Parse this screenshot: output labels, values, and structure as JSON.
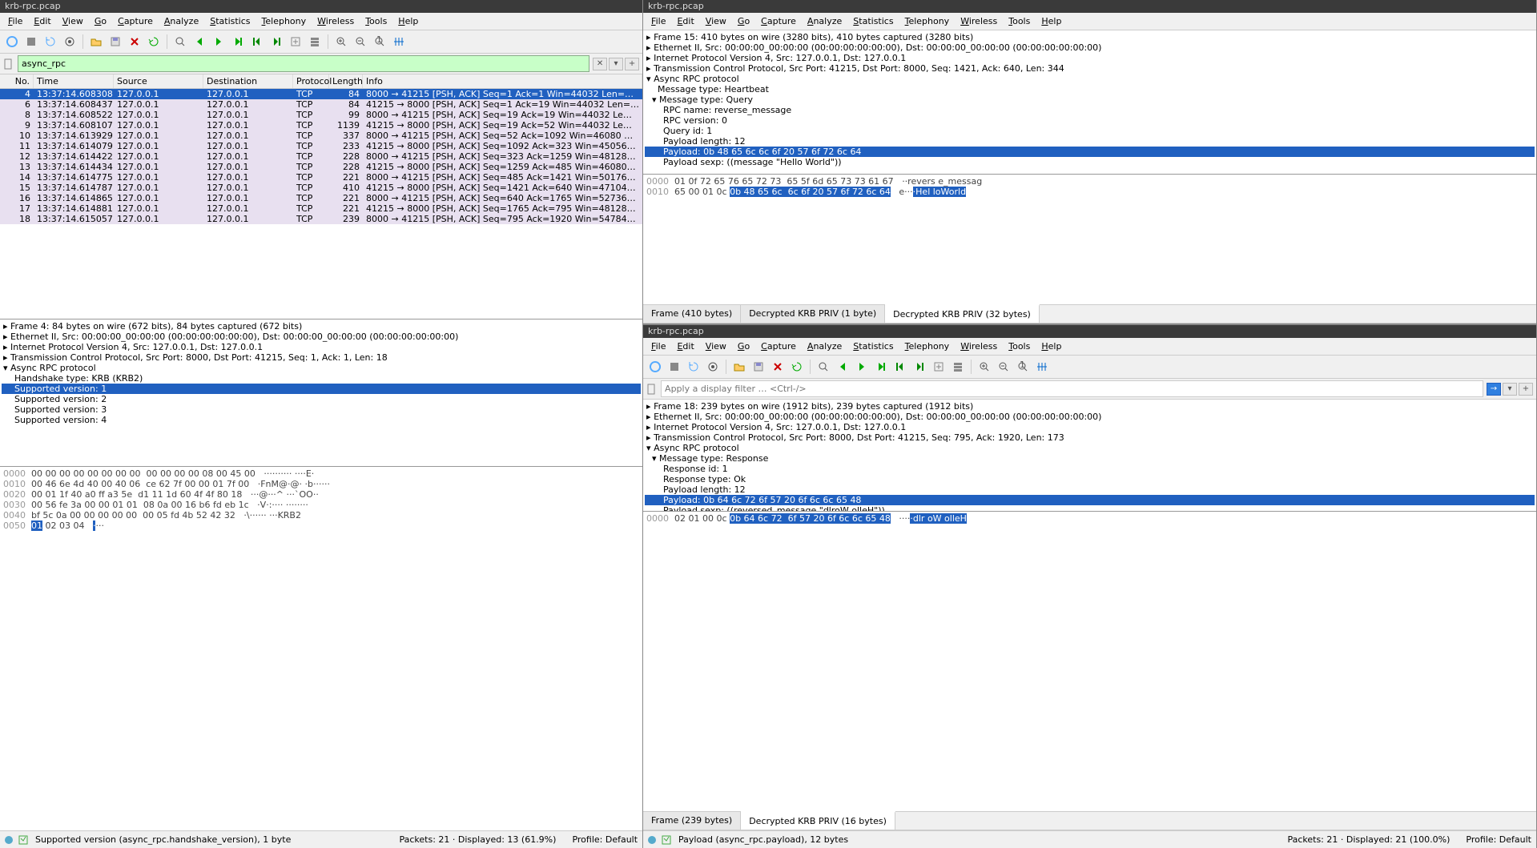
{
  "titles": {
    "left": "krb-rpc.pcap",
    "right_top": "krb-rpc.pcap",
    "right_bot": "krb-rpc.pcap"
  },
  "menu": [
    "File",
    "Edit",
    "View",
    "Go",
    "Capture",
    "Analyze",
    "Statistics",
    "Telephony",
    "Wireless",
    "Tools",
    "Help"
  ],
  "filter": {
    "value": "async_rpc",
    "placeholder": "Apply a display filter … <Ctrl-/>"
  },
  "colhead": {
    "no": "No.",
    "time": "Time",
    "src": "Source",
    "dst": "Destination",
    "proto": "Protocol",
    "len": "Length",
    "info": "Info"
  },
  "packets": [
    {
      "no": 4,
      "time": "13:37:14.608308",
      "src": "127.0.0.1",
      "dst": "127.0.0.1",
      "proto": "TCP",
      "len": 84,
      "info": "8000 → 41215 [PSH, ACK] Seq=1 Ack=1 Win=44032 Len=…",
      "sel": true
    },
    {
      "no": 6,
      "time": "13:37:14.608437",
      "src": "127.0.0.1",
      "dst": "127.0.0.1",
      "proto": "TCP",
      "len": 84,
      "info": "41215 → 8000 [PSH, ACK] Seq=1 Ack=19 Win=44032 Len=…"
    },
    {
      "no": 8,
      "time": "13:37:14.608522",
      "src": "127.0.0.1",
      "dst": "127.0.0.1",
      "proto": "TCP",
      "len": 99,
      "info": "8000 → 41215 [PSH, ACK] Seq=19 Ack=19 Win=44032 Le…"
    },
    {
      "no": 9,
      "time": "13:37:14.608107",
      "src": "127.0.0.1",
      "dst": "127.0.0.1",
      "proto": "TCP",
      "len": 1139,
      "info": "41215 → 8000 [PSH, ACK] Seq=19 Ack=52 Win=44032 Le…"
    },
    {
      "no": 10,
      "time": "13:37:14.613929",
      "src": "127.0.0.1",
      "dst": "127.0.0.1",
      "proto": "TCP",
      "len": 337,
      "info": "8000 → 41215 [PSH, ACK] Seq=52 Ack=1092 Win=46080 …"
    },
    {
      "no": 11,
      "time": "13:37:14.614079",
      "src": "127.0.0.1",
      "dst": "127.0.0.1",
      "proto": "TCP",
      "len": 233,
      "info": "41215 → 8000 [PSH, ACK] Seq=1092 Ack=323 Win=45056…"
    },
    {
      "no": 12,
      "time": "13:37:14.614422",
      "src": "127.0.0.1",
      "dst": "127.0.0.1",
      "proto": "TCP",
      "len": 228,
      "info": "8000 → 41215 [PSH, ACK] Seq=323 Ack=1259 Win=48128…"
    },
    {
      "no": 13,
      "time": "13:37:14.614434",
      "src": "127.0.0.1",
      "dst": "127.0.0.1",
      "proto": "TCP",
      "len": 228,
      "info": "41215 → 8000 [PSH, ACK] Seq=1259 Ack=485 Win=46080…"
    },
    {
      "no": 14,
      "time": "13:37:14.614775",
      "src": "127.0.0.1",
      "dst": "127.0.0.1",
      "proto": "TCP",
      "len": 221,
      "info": "8000 → 41215 [PSH, ACK] Seq=485 Ack=1421 Win=50176…"
    },
    {
      "no": 15,
      "time": "13:37:14.614787",
      "src": "127.0.0.1",
      "dst": "127.0.0.1",
      "proto": "TCP",
      "len": 410,
      "info": "41215 → 8000 [PSH, ACK] Seq=1421 Ack=640 Win=47104…"
    },
    {
      "no": 16,
      "time": "13:37:14.614865",
      "src": "127.0.0.1",
      "dst": "127.0.0.1",
      "proto": "TCP",
      "len": 221,
      "info": "8000 → 41215 [PSH, ACK] Seq=640 Ack=1765 Win=52736…"
    },
    {
      "no": 17,
      "time": "13:37:14.614881",
      "src": "127.0.0.1",
      "dst": "127.0.0.1",
      "proto": "TCP",
      "len": 221,
      "info": "41215 → 8000 [PSH, ACK] Seq=1765 Ack=795 Win=48128…"
    },
    {
      "no": 18,
      "time": "13:37:14.615057",
      "src": "127.0.0.1",
      "dst": "127.0.0.1",
      "proto": "TCP",
      "len": 239,
      "info": "8000 → 41215 [PSH, ACK] Seq=795 Ack=1920 Win=54784…"
    }
  ],
  "details_left": [
    {
      "t": "▸ Frame 4: 84 bytes on wire (672 bits), 84 bytes captured (672 bits)"
    },
    {
      "t": "▸ Ethernet II, Src: 00:00:00_00:00:00 (00:00:00:00:00:00), Dst: 00:00:00_00:00:00 (00:00:00:00:00:00)"
    },
    {
      "t": "▸ Internet Protocol Version 4, Src: 127.0.0.1, Dst: 127.0.0.1"
    },
    {
      "t": "▸ Transmission Control Protocol, Src Port: 8000, Dst Port: 41215, Seq: 1, Ack: 1, Len: 18"
    },
    {
      "t": "▾ Async RPC protocol"
    },
    {
      "t": "    Handshake type: KRB (KRB2)"
    },
    {
      "t": "    Supported version: 1",
      "sel": true
    },
    {
      "t": "    Supported version: 2"
    },
    {
      "t": "    Supported version: 3"
    },
    {
      "t": "    Supported version: 4"
    }
  ],
  "hex_left": [
    {
      "off": "0000",
      "hx": "00 00 00 00 00 00 00 00  00 00 00 00 08 00 45 00",
      "asc": "·········· ····E·"
    },
    {
      "off": "0010",
      "hx": "00 46 6e 4d 40 00 40 06  ce 62 7f 00 00 01 7f 00",
      "asc": "·FnM@·@· ·b······"
    },
    {
      "off": "0020",
      "hx": "00 01 1f 40 a0 ff a3 5e  d1 11 1d 60 4f 4f 80 18",
      "asc": "···@···^ ···`OO··"
    },
    {
      "off": "0030",
      "hx": "00 56 fe 3a 00 00 01 01  08 0a 00 16 b6 fd eb 1c",
      "asc": "·V·:···· ········"
    },
    {
      "off": "0040",
      "hx": "bf 5c 0a 00 00 00 00 00  00 05 fd 4b 52 42 32",
      "asc": "·\\······ ···KRB2"
    },
    {
      "off": "0050",
      "hx": "",
      "hxhl": "01",
      "hxrest": " 02 03 04",
      "asc": "",
      "aschl": "·",
      "ascrest": "···"
    }
  ],
  "details_rt": [
    {
      "t": "▸ Frame 15: 410 bytes on wire (3280 bits), 410 bytes captured (3280 bits)"
    },
    {
      "t": "▸ Ethernet II, Src: 00:00:00_00:00:00 (00:00:00:00:00:00), Dst: 00:00:00_00:00:00 (00:00:00:00:00:00)"
    },
    {
      "t": "▸ Internet Protocol Version 4, Src: 127.0.0.1, Dst: 127.0.0.1"
    },
    {
      "t": "▸ Transmission Control Protocol, Src Port: 41215, Dst Port: 8000, Seq: 1421, Ack: 640, Len: 344"
    },
    {
      "t": "▾ Async RPC protocol"
    },
    {
      "t": "    Message type: Heartbeat"
    },
    {
      "t": "  ▾ Message type: Query"
    },
    {
      "t": "      RPC name: reverse_message"
    },
    {
      "t": "      RPC version: 0"
    },
    {
      "t": "      Query id: 1"
    },
    {
      "t": "      Payload length: 12"
    },
    {
      "t": "      Payload: 0b 48 65 6c 6c 6f 20 57 6f 72 6c 64",
      "sel": true
    },
    {
      "t": "      Payload sexp: ((message \"Hello World\"))"
    }
  ],
  "hex_rt": [
    {
      "off": "0000",
      "hx": "01 0f 72 65 76 65 72 73  65 5f 6d 65 73 73 61 67",
      "asc": "··revers e_messag"
    },
    {
      "off": "0010",
      "hx": "65 00 01 0c ",
      "hxhl": "0b 48 65 6c  6c 6f 20 57 6f 72 6c 64",
      "asc": "e···",
      "aschl": "·Hel loWorld"
    }
  ],
  "tabs_rt": [
    {
      "label": "Frame (410 bytes)"
    },
    {
      "label": "Decrypted KRB PRIV (1 byte)"
    },
    {
      "label": "Decrypted KRB PRIV (32 bytes)",
      "active": true
    }
  ],
  "details_rb": [
    {
      "t": "▸ Frame 18: 239 bytes on wire (1912 bits), 239 bytes captured (1912 bits)"
    },
    {
      "t": "▸ Ethernet II, Src: 00:00:00_00:00:00 (00:00:00:00:00:00), Dst: 00:00:00_00:00:00 (00:00:00:00:00:00)"
    },
    {
      "t": "▸ Internet Protocol Version 4, Src: 127.0.0.1, Dst: 127.0.0.1"
    },
    {
      "t": "▸ Transmission Control Protocol, Src Port: 8000, Dst Port: 41215, Seq: 795, Ack: 1920, Len: 173"
    },
    {
      "t": "▾ Async RPC protocol"
    },
    {
      "t": "  ▾ Message type: Response"
    },
    {
      "t": "      Response id: 1"
    },
    {
      "t": "      Response type: Ok"
    },
    {
      "t": "      Payload length: 12"
    },
    {
      "t": "      Payload: 0b 64 6c 72 6f 57 20 6f 6c 6c 65 48",
      "sel": true
    },
    {
      "t": "      Payload sexp: ((reversed_message \"dlroW olleH\"))"
    }
  ],
  "hex_rb": [
    {
      "off": "0000",
      "hx": "02 01 00 0c ",
      "hxhl": "0b 64 6c 72  6f 57 20 6f 6c 6c 65 48",
      "asc": "····",
      "aschl": "·dlr oW olleH"
    }
  ],
  "tabs_rb": [
    {
      "label": "Frame (239 bytes)"
    },
    {
      "label": "Decrypted KRB PRIV (16 bytes)",
      "active": true
    }
  ],
  "status": {
    "left_field": "Supported version (async_rpc.handshake_version), 1 byte",
    "left_pkts": "Packets: 21 · Displayed: 13 (61.9%)",
    "left_prof": "Profile: Default",
    "rb_field": "Payload (async_rpc.payload), 12 bytes",
    "rb_pkts": "Packets: 21 · Displayed: 21 (100.0%)",
    "rb_prof": "Profile: Default"
  }
}
